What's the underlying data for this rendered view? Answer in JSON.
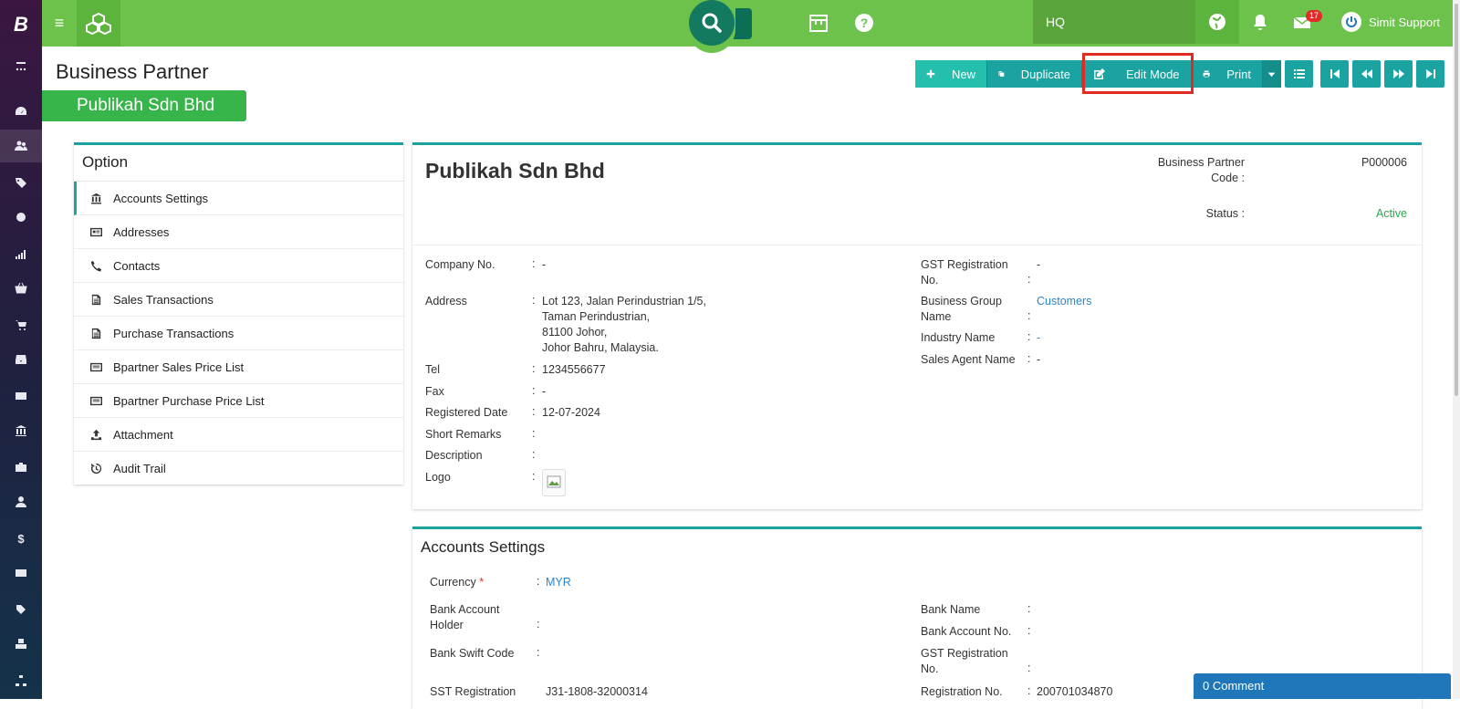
{
  "topbar": {
    "location": "HQ",
    "mail_badge": "17",
    "user_name": "Simit Support"
  },
  "page": {
    "title": "Business Partner",
    "partner_badge": "Publikah Sdn Bhd"
  },
  "toolbar": {
    "new_label": "New",
    "duplicate_label": "Duplicate",
    "edit_label": "Edit Mode",
    "print_label": "Print"
  },
  "option": {
    "title": "Option",
    "items": [
      {
        "label": "Accounts Settings",
        "icon": "bank-icon"
      },
      {
        "label": "Addresses",
        "icon": "address-card-icon"
      },
      {
        "label": "Contacts",
        "icon": "phone-icon"
      },
      {
        "label": "Sales Transactions",
        "icon": "document-icon"
      },
      {
        "label": "Purchase Transactions",
        "icon": "document-icon"
      },
      {
        "label": "Bpartner Sales Price List",
        "icon": "list-icon"
      },
      {
        "label": "Bpartner Purchase Price List",
        "icon": "list-icon"
      },
      {
        "label": "Attachment",
        "icon": "upload-icon"
      },
      {
        "label": "Audit Trail",
        "icon": "history-icon"
      }
    ]
  },
  "partner": {
    "name": "Publikah Sdn Bhd",
    "code_label_1": "Business Partner",
    "code_label_2": "Code :",
    "code": "P000006",
    "status_label": "Status :",
    "status": "Active",
    "fields_left": {
      "company_no_label": "Company No.",
      "company_no": "-",
      "address_label": "Address",
      "address_1": "Lot 123, Jalan Perindustrian 1/5,",
      "address_2": "Taman Perindustrian,",
      "address_3": "81100 Johor,",
      "address_4": "Johor Bahru, Malaysia.",
      "tel_label": "Tel",
      "tel": "1234556677",
      "fax_label": "Fax",
      "fax": "-",
      "registered_date_label": "Registered Date",
      "registered_date": "12-07-2024",
      "short_remarks_label": "Short Remarks",
      "description_label": "Description",
      "logo_label": "Logo"
    },
    "fields_right": {
      "gst_label_1": "GST Registration",
      "gst_label_2": "No.",
      "gst": "-",
      "business_group_label_1": "Business Group",
      "business_group_label_2": "Name",
      "business_group": "Customers",
      "industry_label": "Industry Name",
      "industry": "-",
      "sales_agent_label": "Sales Agent Name",
      "sales_agent": "-"
    }
  },
  "accounts": {
    "title": "Accounts Settings",
    "currency_label": "Currency",
    "currency": "MYR",
    "bank_holder_label_1": "Bank Account",
    "bank_holder_label_2": "Holder",
    "bank_swift_label": "Bank Swift Code",
    "sst_label": "SST Registration",
    "sst": "J31-1808-32000314",
    "bank_name_label": "Bank Name",
    "bank_account_no_label": "Bank Account No.",
    "gst_label_1": "GST Registration",
    "gst_label_2": "No.",
    "registration_no_label": "Registration No.",
    "registration_no": "200701034870"
  },
  "comment_bar": "0 Comment"
}
